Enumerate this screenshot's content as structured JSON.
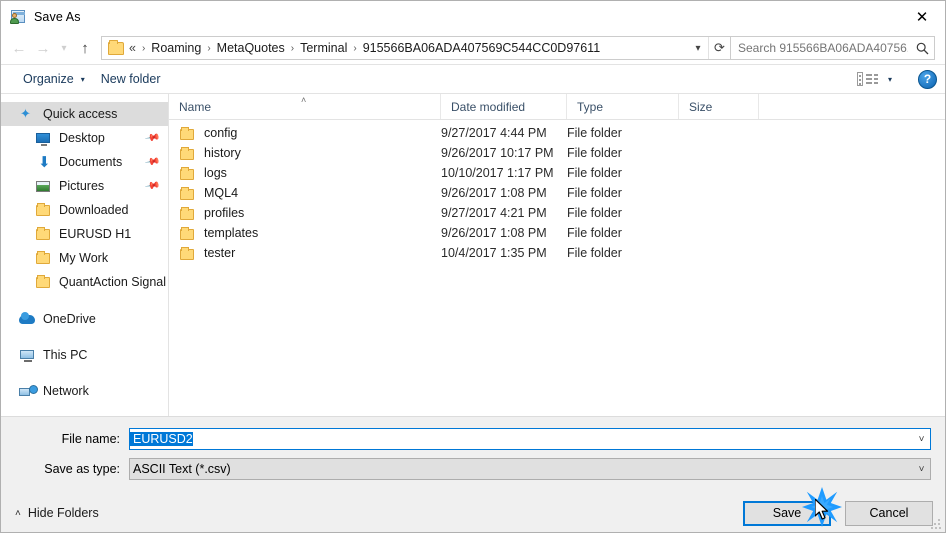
{
  "window": {
    "title": "Save As",
    "title_icon": "save-as-icon",
    "close_icon": "close-icon"
  },
  "navigation": {
    "back_icon": "arrow-left-icon",
    "forward_icon": "arrow-right-icon",
    "recent_icon": "chevron-down-icon",
    "up_icon": "arrow-up-icon",
    "folder_icon": "folder-icon",
    "breadcrumb_lead": "«",
    "breadcrumbs": [
      "Roaming",
      "MetaQuotes",
      "Terminal",
      "915566BA06ADA407569C544CC0D97611"
    ],
    "separator": "›",
    "dropdown_icon": "chevron-down-icon",
    "refresh_icon": "refresh-icon"
  },
  "search": {
    "placeholder": "Search 915566BA06ADA40756...",
    "value": "",
    "icon": "search-icon"
  },
  "toolbar": {
    "organize_label": "Organize",
    "organize_caret": "▾",
    "new_folder_label": "New folder",
    "view_icon": "view-layout-icon",
    "view_caret": "▾",
    "help_label": "?",
    "help_icon": "help-icon"
  },
  "sidebar": {
    "items": [
      {
        "label": "Quick access",
        "icon": "star-icon",
        "level": "root",
        "selected": true,
        "pinned": false
      },
      {
        "label": "Desktop",
        "icon": "desktop-icon",
        "level": "child",
        "selected": false,
        "pinned": true
      },
      {
        "label": "Documents",
        "icon": "documents-icon",
        "level": "child",
        "selected": false,
        "pinned": true
      },
      {
        "label": "Pictures",
        "icon": "pictures-icon",
        "level": "child",
        "selected": false,
        "pinned": true
      },
      {
        "label": "Downloaded",
        "icon": "folder-icon",
        "level": "child",
        "selected": false,
        "pinned": false
      },
      {
        "label": "EURUSD H1",
        "icon": "folder-icon",
        "level": "child",
        "selected": false,
        "pinned": false
      },
      {
        "label": "My Work",
        "icon": "folder-icon",
        "level": "child",
        "selected": false,
        "pinned": false
      },
      {
        "label": "QuantAction Signal",
        "icon": "folder-icon",
        "level": "child",
        "selected": false,
        "pinned": false
      },
      {
        "label": "OneDrive",
        "icon": "onedrive-icon",
        "level": "root",
        "selected": false,
        "pinned": false
      },
      {
        "label": "This PC",
        "icon": "this-pc-icon",
        "level": "root",
        "selected": false,
        "pinned": false
      },
      {
        "label": "Network",
        "icon": "network-icon",
        "level": "root",
        "selected": false,
        "pinned": false
      }
    ],
    "pin_icon": "pin-icon"
  },
  "filelist": {
    "columns": [
      "Name",
      "Date modified",
      "Type",
      "Size"
    ],
    "sort_column": "Name",
    "sort_caret": "˄",
    "rows": [
      {
        "name": "config",
        "date": "9/27/2017 4:44 PM",
        "type": "File folder",
        "size": ""
      },
      {
        "name": "history",
        "date": "9/26/2017 10:17 PM",
        "type": "File folder",
        "size": ""
      },
      {
        "name": "logs",
        "date": "10/10/2017 1:17 PM",
        "type": "File folder",
        "size": ""
      },
      {
        "name": "MQL4",
        "date": "9/26/2017 1:08 PM",
        "type": "File folder",
        "size": ""
      },
      {
        "name": "profiles",
        "date": "9/27/2017 4:21 PM",
        "type": "File folder",
        "size": ""
      },
      {
        "name": "templates",
        "date": "9/26/2017 1:08 PM",
        "type": "File folder",
        "size": ""
      },
      {
        "name": "tester",
        "date": "10/4/2017 1:35 PM",
        "type": "File folder",
        "size": ""
      }
    ]
  },
  "form": {
    "filename_label": "File name:",
    "filename_value": "EURUSD2",
    "filename_caret": "˅",
    "savetype_label": "Save as type:",
    "savetype_value": "ASCII Text (*.csv)",
    "savetype_caret": "˅"
  },
  "footer": {
    "hide_folders_label": "Hide Folders",
    "hide_folders_caret": "˄",
    "save_label": "Save",
    "cancel_label": "Cancel"
  },
  "colors": {
    "accent": "#0078d7",
    "selection": "#0078d7",
    "folder": "#ffd978",
    "click_burst": "#1f9bff"
  }
}
